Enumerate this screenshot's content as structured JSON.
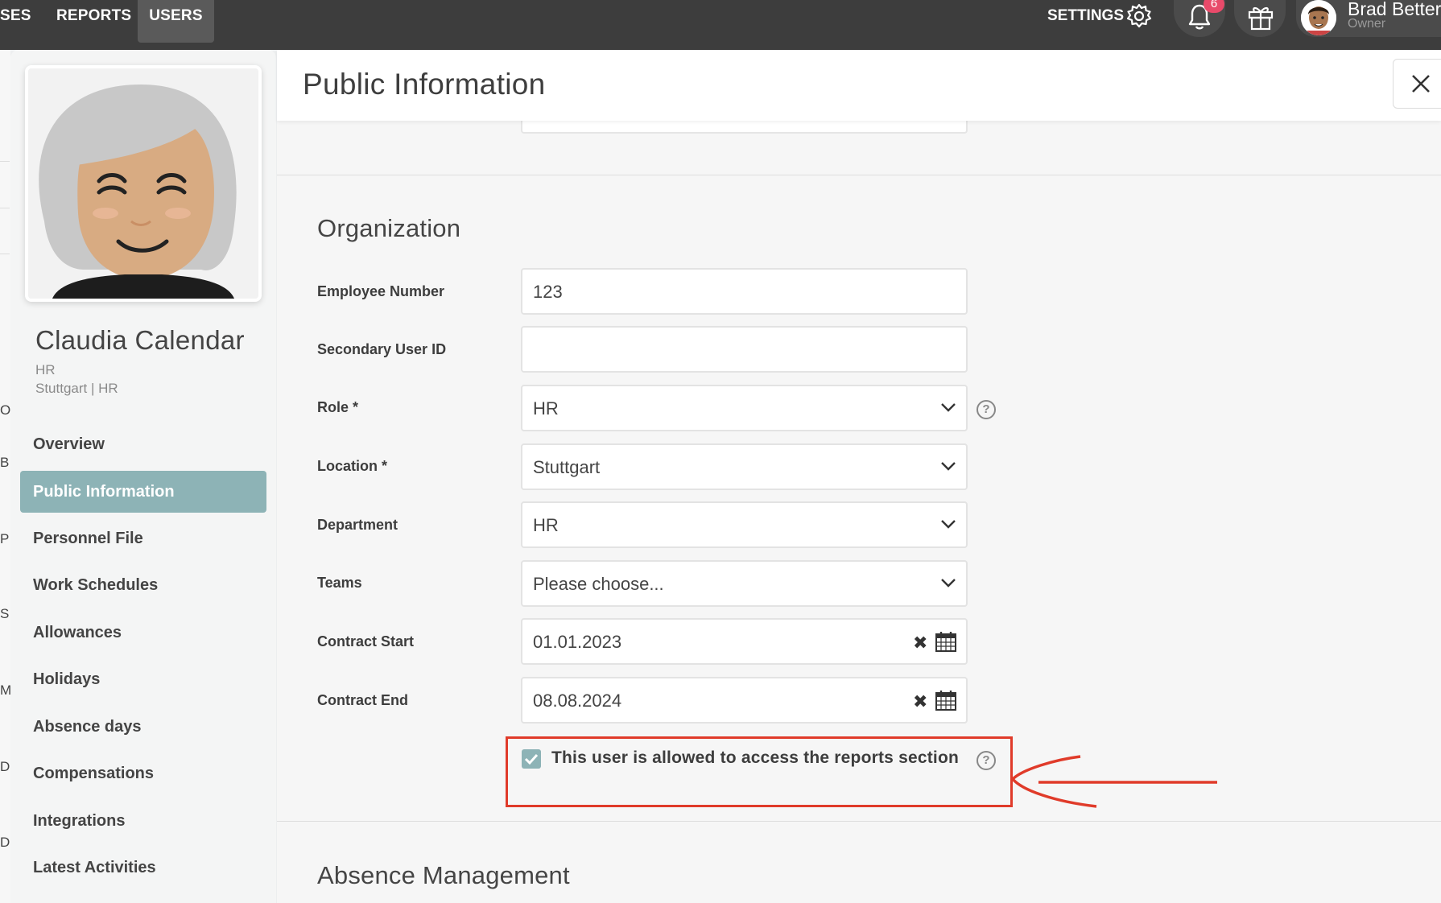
{
  "topnav": {
    "items": [
      "SES",
      "REPORTS",
      "USERS"
    ],
    "settings_label": "SETTINGS",
    "notification_count": "6",
    "user_name": "Brad Better",
    "user_role": "Owner"
  },
  "left_strip": [
    "O",
    "B",
    "P",
    "S",
    "M",
    "D",
    "D"
  ],
  "profile": {
    "name": "Claudia Calendar",
    "role": "HR",
    "location_department": "Stuttgart | HR"
  },
  "sidebar": {
    "items": [
      {
        "label": "Overview",
        "active": false
      },
      {
        "label": "Public Information",
        "active": true
      },
      {
        "label": "Personnel File",
        "active": false
      },
      {
        "label": "Work Schedules",
        "active": false
      },
      {
        "label": "Allowances",
        "active": false
      },
      {
        "label": "Holidays",
        "active": false
      },
      {
        "label": "Absence days",
        "active": false
      },
      {
        "label": "Compensations",
        "active": false
      },
      {
        "label": "Integrations",
        "active": false
      },
      {
        "label": "Latest Activities",
        "active": false
      }
    ]
  },
  "main": {
    "title": "Public Information",
    "organization": {
      "title": "Organization",
      "fields": [
        {
          "label": "Employee Number",
          "value": "123",
          "type": "text"
        },
        {
          "label": "Secondary User ID",
          "value": "",
          "type": "text"
        },
        {
          "label": "Role *",
          "value": "HR",
          "type": "select"
        },
        {
          "label": "Location *",
          "value": "Stuttgart",
          "type": "select"
        },
        {
          "label": "Department",
          "value": "HR",
          "type": "select"
        },
        {
          "label": "Teams",
          "value": "Please choose...",
          "type": "select"
        },
        {
          "label": "Contract Start",
          "value": "01.01.2023",
          "type": "date"
        },
        {
          "label": "Contract End",
          "value": "08.08.2024",
          "type": "date"
        }
      ],
      "reports_access_label": "This user is allowed to access the reports section",
      "reports_access_checked": true
    },
    "absence_title": "Absence Management"
  },
  "colors": {
    "topbar": "#3d3d3d",
    "accent": "#8db3b6",
    "highlight": "#e03b2a"
  }
}
